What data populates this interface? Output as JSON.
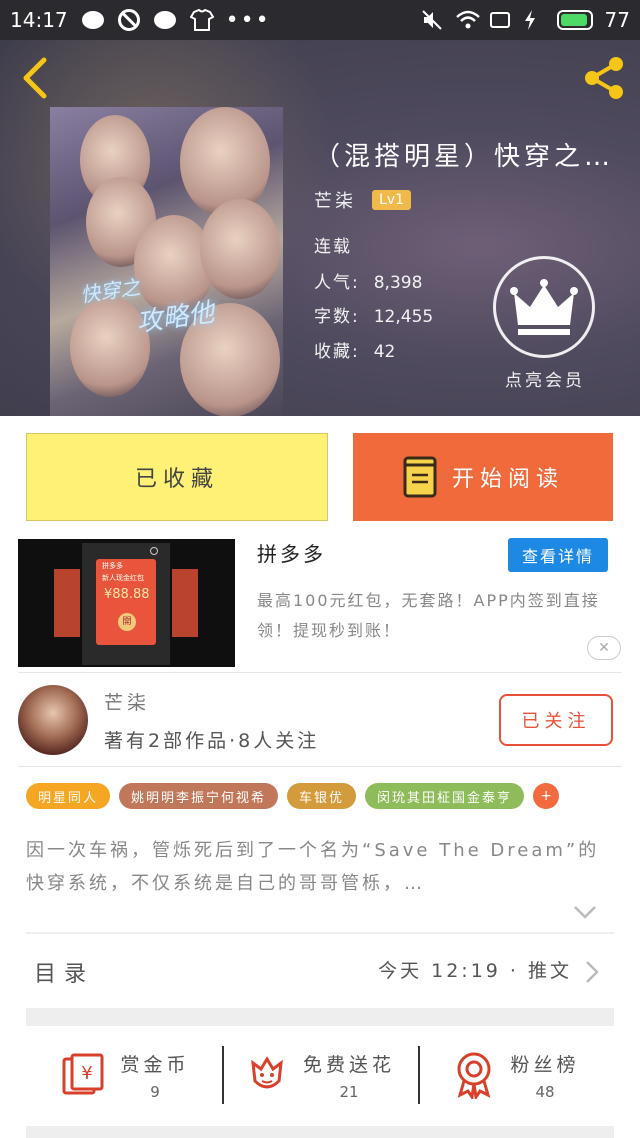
{
  "status_bar": {
    "time": "14:17",
    "battery": "77"
  },
  "book": {
    "title": "（混搭明星）快穿之…",
    "author": "芒柒",
    "level": "Lv1",
    "status": "连载",
    "popularity_label": "人气:",
    "popularity": "8,398",
    "word_count_label": "字数:",
    "word_count": "12,455",
    "favorites_label": "收藏:",
    "favorites": "42",
    "cover_text_1": "快穿之",
    "cover_text_2": "攻略他"
  },
  "vip": {
    "label": "点亮会员"
  },
  "actions": {
    "favorite_label": "已收藏",
    "read_label": "开始阅读"
  },
  "ad": {
    "title": "拼多多",
    "detail_label": "查看详情",
    "description": "最高100元红包，无套路！APP内签到直接领！提现秒到账！",
    "close_label": "✕",
    "thumb_brand": "拼多多",
    "thumb_text": "新人现金红包",
    "thumb_amount": "¥88.88",
    "thumb_btn": "開"
  },
  "author_card": {
    "name": "芒柒",
    "stats": "著有2部作品·8人关注",
    "follow_label": "已关注"
  },
  "tags": [
    {
      "label": "明星同人",
      "color": "#f5a623"
    },
    {
      "label": "姚明明李振宁何视希",
      "color": "#c0775a"
    },
    {
      "label": "车银优",
      "color": "#d39b3b"
    },
    {
      "label": "闵玧其田柾国金泰亨",
      "color": "#8fbc5a"
    }
  ],
  "tag_more": "+",
  "summary": "因一次车祸，管烁死后到了一个名为“Save The Dream”的快穿系统，不仅系统是自己的哥哥管栎，…",
  "catalog": {
    "label": "目录",
    "update": "今天 12:19 · 推文"
  },
  "bottom": {
    "coins_label": "赏金币",
    "coins": "9",
    "flowers_label": "免费送花",
    "flowers": "21",
    "fans_label": "粉丝榜",
    "fans": "48"
  }
}
